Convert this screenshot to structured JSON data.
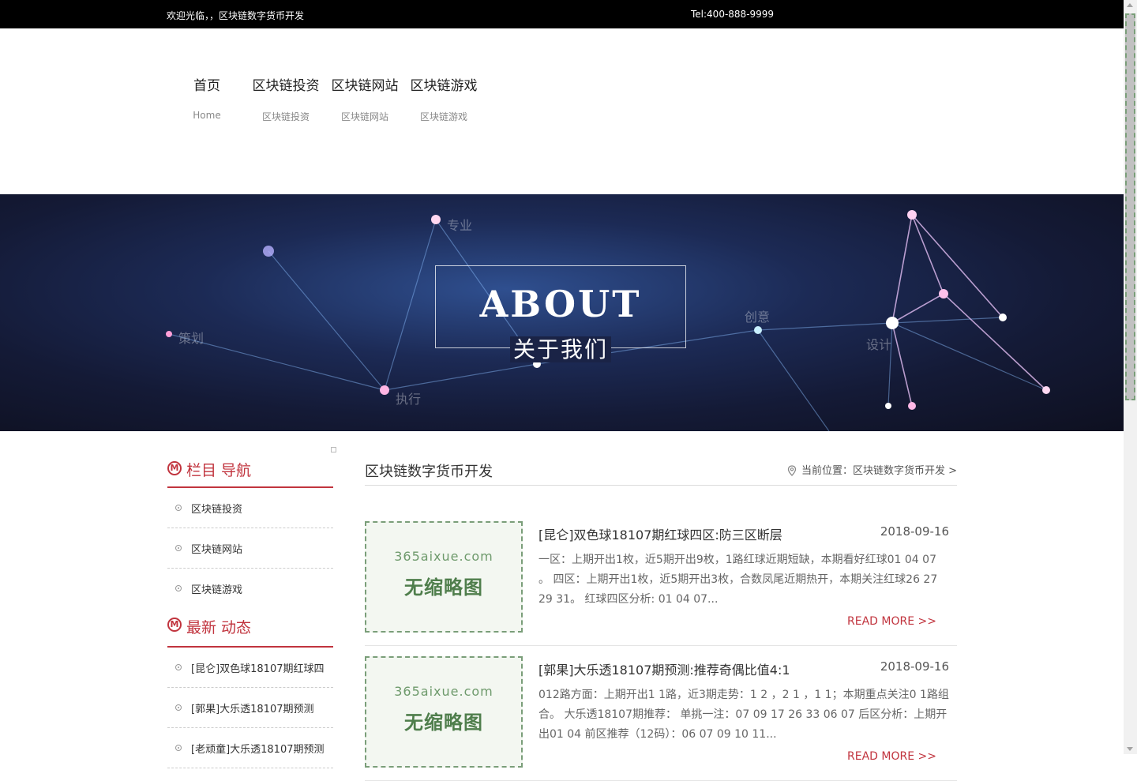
{
  "topbar": {
    "welcome": "欢迎光临，，区块链数字货币开发",
    "tel": "Tel:400-888-9999"
  },
  "nav": {
    "items": [
      {
        "cn": "首页",
        "en": "Home"
      },
      {
        "cn": "区块链投资",
        "en": "区块链投资"
      },
      {
        "cn": "区块链网站",
        "en": "区块链网站"
      },
      {
        "cn": "区块链游戏",
        "en": "区块链游戏"
      }
    ]
  },
  "banner": {
    "title": "ABOUT",
    "subtitle": "关于我们",
    "words": [
      "专业",
      "策划",
      "创意",
      "设计",
      "执行"
    ]
  },
  "sidebar": {
    "nav_head": {
      "a": "栏目",
      "b": " 导航"
    },
    "nav_items": [
      "区块链投资",
      "区块链网站",
      "区块链游戏"
    ],
    "news_head": {
      "a": "最新",
      "b": " 动态"
    },
    "news_items": [
      "[昆仑]双色球18107期红球四",
      "[郭果]大乐透18107期预测",
      "[老顽童]大乐透18107期预测"
    ]
  },
  "main": {
    "title": "区块链数字货币开发",
    "location": "当前位置：区块链数字货币开发 >",
    "articles": [
      {
        "title": "[昆仑]双色球18107期红球四区:防三区断层",
        "date": "2018-09-16",
        "text": "一区：上期开出1枚，近5期开出9枚，1路红球近期短缺，本期看好红球01 04 07 。 四区：上期开出1枚，近5期开出3枚，合数凤尾近期热开，本期关注红球26 27 29 31。 红球四区分析: 01 04 07...",
        "more": "READ MORE >>",
        "thumb_site": "365aixue.com",
        "thumb_text": "无缩略图"
      },
      {
        "title": "[郭果]大乐透18107期预测:推荐奇偶比值4:1",
        "date": "2018-09-16",
        "text": "012路方面：上期开出1 1路，近3期走势：1 2 ，2 1 ，1 1；本期重点关注0 1路组合。 大乐透18107期推荐： 单挑一注：07 09 17 26 33 06 07 后区分析：上期开出01 04 前区推荐（12码）：06 07 09 10 11...",
        "more": "READ MORE >>",
        "thumb_site": "365aixue.com",
        "thumb_text": "无缩略图"
      }
    ]
  },
  "colors": {
    "accent": "#c1343e",
    "topbar_bg": "#000000",
    "thumb_green": "#4f7e4c"
  }
}
